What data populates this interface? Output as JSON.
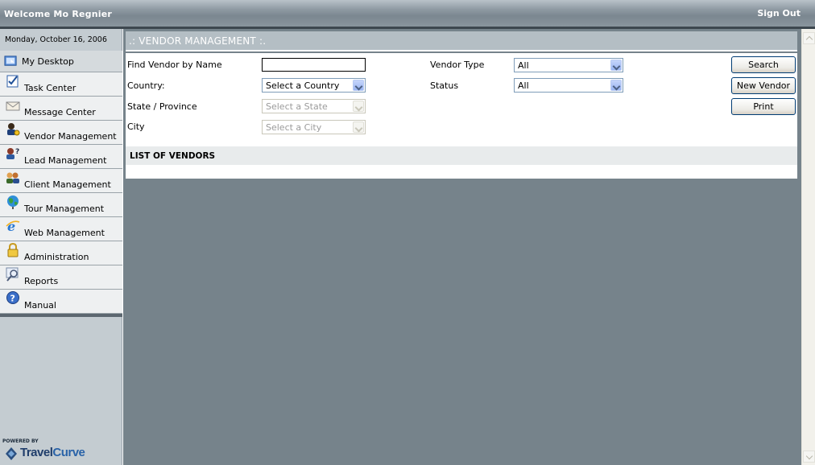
{
  "header": {
    "welcome": "Welcome Mo Regnier",
    "sign_out": "Sign Out"
  },
  "sidebar": {
    "date": "Monday, October 16, 2006",
    "items": [
      {
        "label": "My Desktop",
        "icon": "desktop-icon"
      },
      {
        "label": "Task Center",
        "icon": "task-icon"
      },
      {
        "label": "Message Center",
        "icon": "envelope-icon"
      },
      {
        "label": "Vendor Management",
        "icon": "vendor-icon"
      },
      {
        "label": "Lead Management",
        "icon": "lead-icon"
      },
      {
        "label": "Client Management",
        "icon": "clients-icon"
      },
      {
        "label": "Tour Management",
        "icon": "globe-icon"
      },
      {
        "label": "Web Management",
        "icon": "ie-icon"
      },
      {
        "label": "Administration",
        "icon": "lock-icon"
      },
      {
        "label": "Reports",
        "icon": "magnifier-icon"
      },
      {
        "label": "Manual",
        "icon": "help-icon"
      }
    ],
    "powered_by": "POWERED BY",
    "logo_a": "Travel",
    "logo_b": "Curve"
  },
  "main": {
    "title": ".: VENDOR MANAGEMENT :.",
    "form": {
      "find_label": "Find Vendor by Name",
      "find_value": "",
      "country_label": "Country:",
      "country_value": "Select a Country",
      "state_label": "State / Province",
      "state_value": "Select a State",
      "city_label": "City",
      "city_value": "Select a City",
      "vendor_type_label": "Vendor Type",
      "vendor_type_value": "All",
      "status_label": "Status",
      "status_value": "All"
    },
    "buttons": {
      "search": "Search",
      "new_vendor": "New Vendor",
      "print": "Print"
    },
    "list_title": "LIST OF VENDORS"
  },
  "colors": {
    "accent": "#76838b",
    "menu_bg": "#eef0f1",
    "topbar": "#8f9aa3"
  }
}
